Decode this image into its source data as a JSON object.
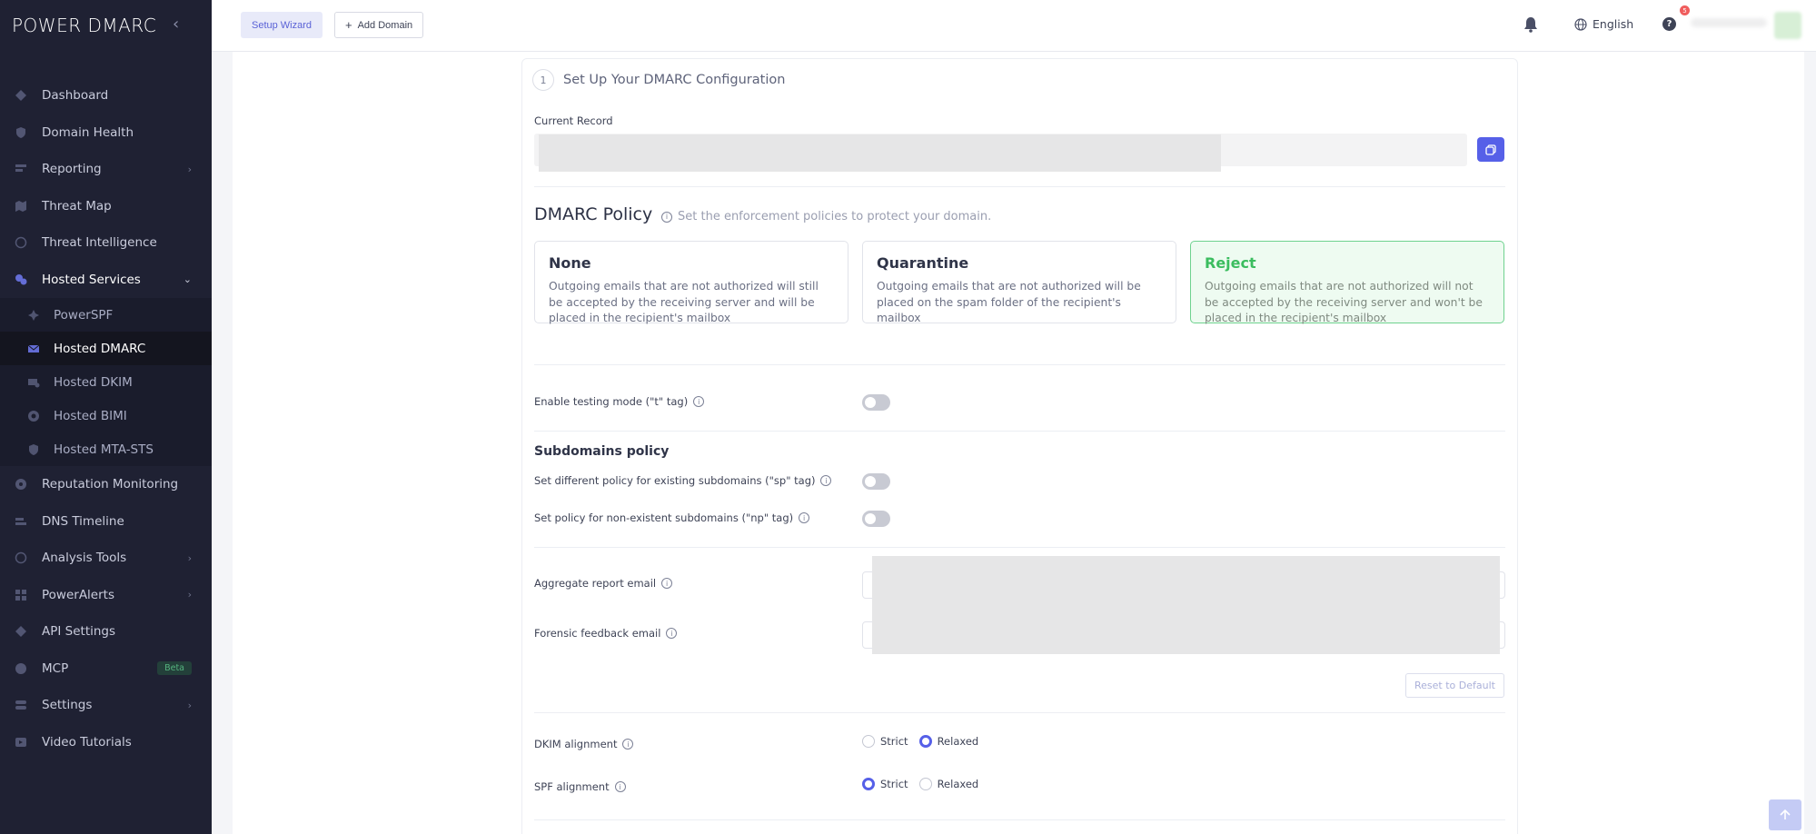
{
  "brand": {
    "logo_text": "POWER DMARC"
  },
  "sidebar": {
    "items": [
      {
        "label": "Dashboard",
        "icon": "dashboard-icon"
      },
      {
        "label": "Domain Health",
        "icon": "shield-icon"
      },
      {
        "label": "Reporting",
        "icon": "report-icon",
        "has_children": true
      },
      {
        "label": "Threat Map",
        "icon": "map-icon"
      },
      {
        "label": "Threat Intelligence",
        "icon": "target-icon"
      },
      {
        "label": "Hosted Services",
        "icon": "cloud-icon",
        "expanded": true
      }
    ],
    "sub_items": [
      {
        "label": "PowerSPF",
        "icon": "spf-icon"
      },
      {
        "label": "Hosted DMARC",
        "icon": "mail-icon",
        "active": true
      },
      {
        "label": "Hosted DKIM",
        "icon": "key-mail-icon"
      },
      {
        "label": "Hosted BIMI",
        "icon": "gear-badge-icon"
      },
      {
        "label": "Hosted MTA-STS",
        "icon": "shield-check-icon"
      }
    ],
    "items_after": [
      {
        "label": "Reputation Monitoring",
        "icon": "reputation-icon"
      },
      {
        "label": "DNS Timeline",
        "icon": "timeline-icon"
      },
      {
        "label": "Analysis Tools",
        "icon": "tools-icon",
        "has_children": true
      },
      {
        "label": "PowerAlerts",
        "icon": "alerts-icon",
        "has_children": true
      },
      {
        "label": "API Settings",
        "icon": "api-icon"
      },
      {
        "label": "MCP",
        "icon": "mcp-icon",
        "badge": "Beta"
      },
      {
        "label": "Settings",
        "icon": "settings-icon",
        "has_children": true
      },
      {
        "label": "Video Tutorials",
        "icon": "video-icon"
      }
    ]
  },
  "topbar": {
    "setup_wizard": "Setup Wizard",
    "add_domain": "Add Domain",
    "language": "English",
    "help_badge": "5"
  },
  "config": {
    "step_number": "1",
    "step_title": "Set Up Your DMARC Configuration",
    "current_record_label": "Current Record",
    "policy_title": "DMARC Policy",
    "policy_hint": "Set the enforcement policies to protect your domain.",
    "policies": [
      {
        "name": "None",
        "desc": "Outgoing emails that are not authorized will still be accepted by the receiving server and will be placed in the recipient's mailbox"
      },
      {
        "name": "Quarantine",
        "desc": "Outgoing emails that are not authorized will be placed on the spam folder of the recipient's mailbox"
      },
      {
        "name": "Reject",
        "desc": "Outgoing emails that are not authorized will not be accepted by the receiving server and won't be placed in the recipient's mailbox",
        "selected": true
      }
    ],
    "testing_mode_label": "Enable testing mode (\"t\" tag)",
    "subdomains_heading": "Subdomains policy",
    "sp_label": "Set different policy for existing subdomains (\"sp\" tag)",
    "np_label": "Set policy for non-existent subdomains (\"np\" tag)",
    "aggregate_label": "Aggregate report email",
    "forensic_label": "Forensic feedback email",
    "reset_label": "Reset to Default",
    "dkim_label": "DKIM alignment",
    "spf_label": "SPF alignment",
    "strict": "Strict",
    "relaxed": "Relaxed",
    "dkim_alignment": "Relaxed",
    "spf_alignment": "Strict"
  },
  "colors": {
    "sidebar_bg": "#1f2133",
    "accent": "#5660e8",
    "reject_green": "#3bbd5f"
  }
}
